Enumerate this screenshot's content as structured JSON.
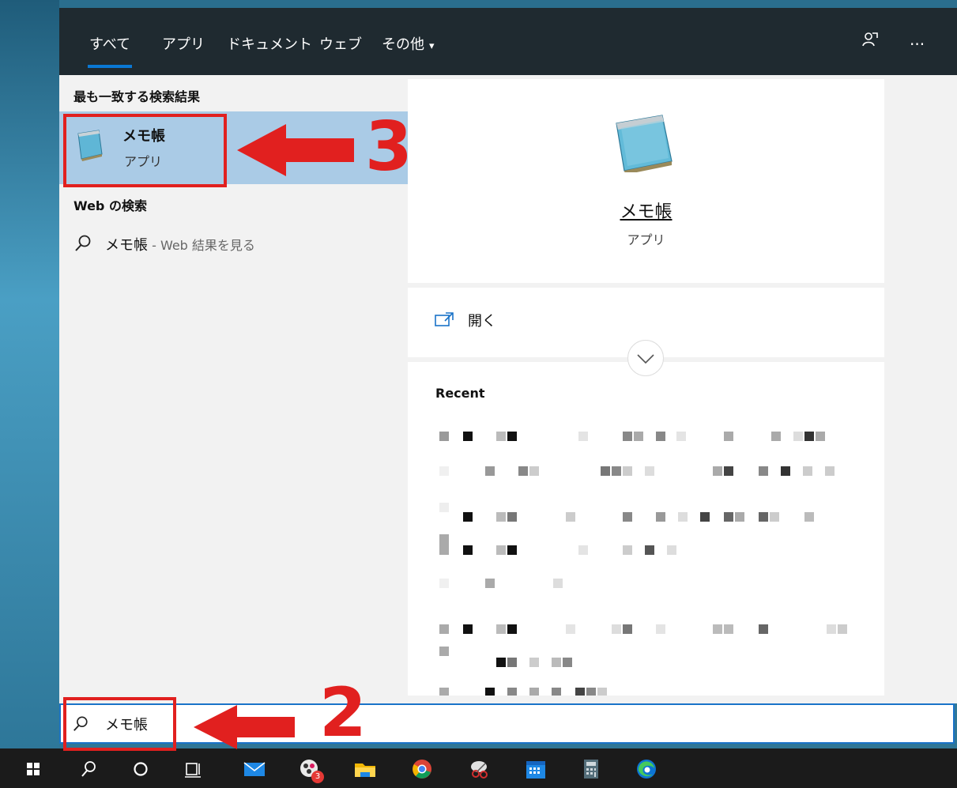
{
  "tabs": [
    {
      "label": "すべて",
      "active": true
    },
    {
      "label": "アプリ"
    },
    {
      "label": "ドキュメント"
    },
    {
      "label": "ウェブ"
    },
    {
      "label": "その他"
    }
  ],
  "more_caret": "▾",
  "toolbar_icons": [
    "feedback-icon",
    "more-options-icon"
  ],
  "more_options_glyph": "···",
  "left": {
    "best_match_heading": "最も一致する検索結果",
    "best_match": {
      "name": "メモ帳",
      "type": "アプリ"
    },
    "web_heading": "Web の検索",
    "web_result": {
      "query": "メモ帳",
      "suffix": " - Web 結果を見る",
      "chevron": "›"
    }
  },
  "detail": {
    "title": "メモ帳",
    "type": "アプリ",
    "open_label": "開く",
    "recent_heading": "Recent"
  },
  "search": {
    "value": "メモ帳"
  },
  "taskbar": [
    "windows-start-icon",
    "search-icon",
    "cortana-icon",
    "task-view-icon",
    "mail-icon",
    "app-icon-with-badge",
    "file-explorer-icon",
    "chrome-icon",
    "snipping-tool-icon",
    "calendar-icon",
    "calculator-icon",
    "edge-icon"
  ],
  "app_badge_count": "3",
  "annotations": {
    "step_3": "3",
    "step_2": "2"
  },
  "colors": {
    "accent": "#0a78d4",
    "highlight": "#aacbe6",
    "annotation_red": "#e1201f"
  }
}
